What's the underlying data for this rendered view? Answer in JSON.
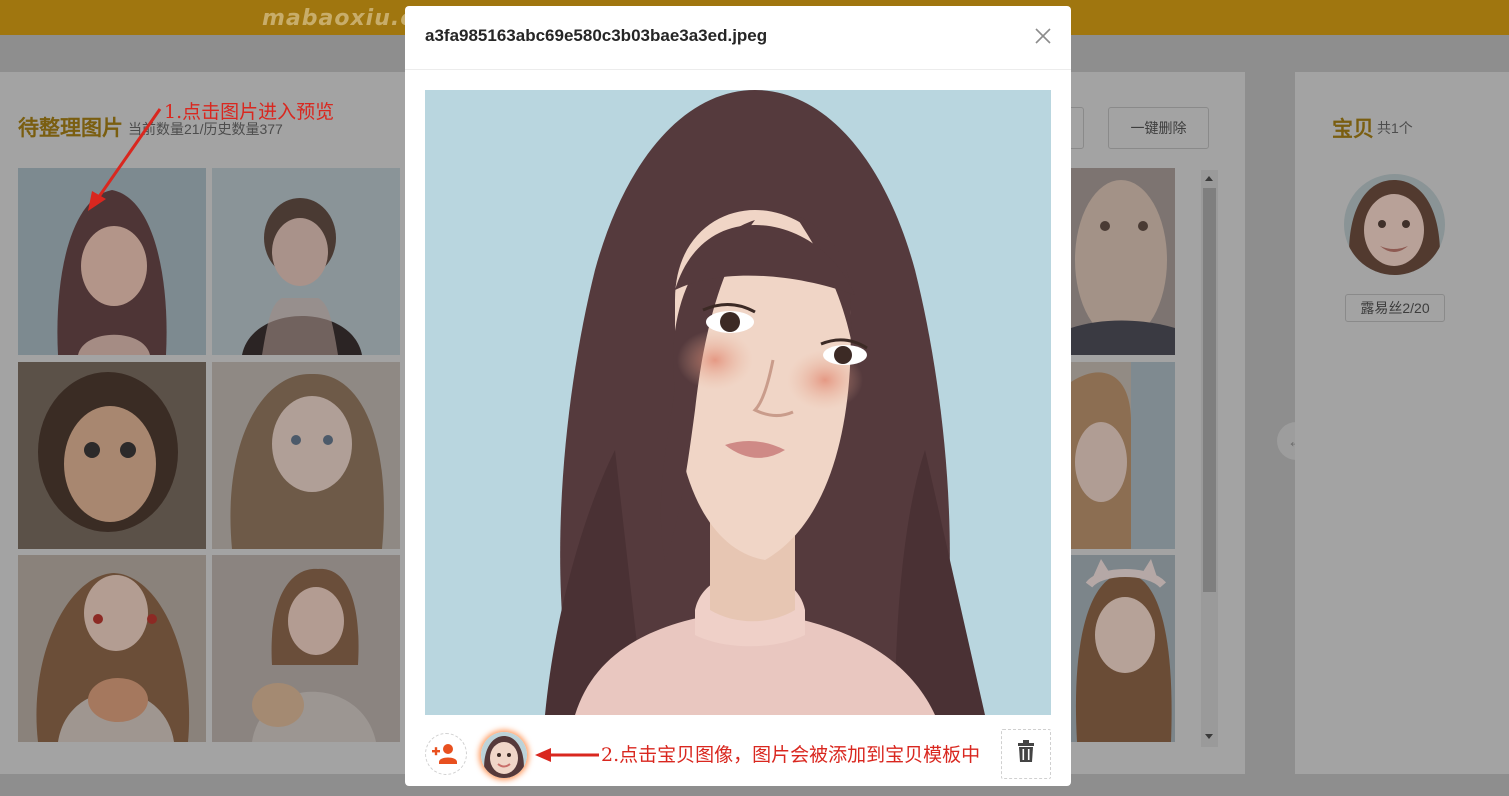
{
  "header": {
    "logo_text": "mabaoxiu.cn"
  },
  "left_panel": {
    "title": "待整理图片",
    "subtitle": "当前数量21/历史数量377",
    "one_click_delete": "一键删除"
  },
  "right_panel": {
    "title": "宝贝",
    "count": "共1个",
    "baby_tag": "露易丝2/20"
  },
  "annotations": {
    "step1": "1.点击图片进入预览",
    "step2": "2.点击宝贝图像，图片会被添加到宝贝模板中"
  },
  "modal": {
    "title": "a3fa985163abc69e580c3b03bae3a3ed.jpeg"
  },
  "icons": {
    "close": "close-icon",
    "add_user": "add-user-icon",
    "delete": "trash-icon",
    "collapse": "arrow-left-icon"
  },
  "colors": {
    "brand": "#a0760f",
    "accent": "#e8501f",
    "annotation": "#d9271f"
  }
}
